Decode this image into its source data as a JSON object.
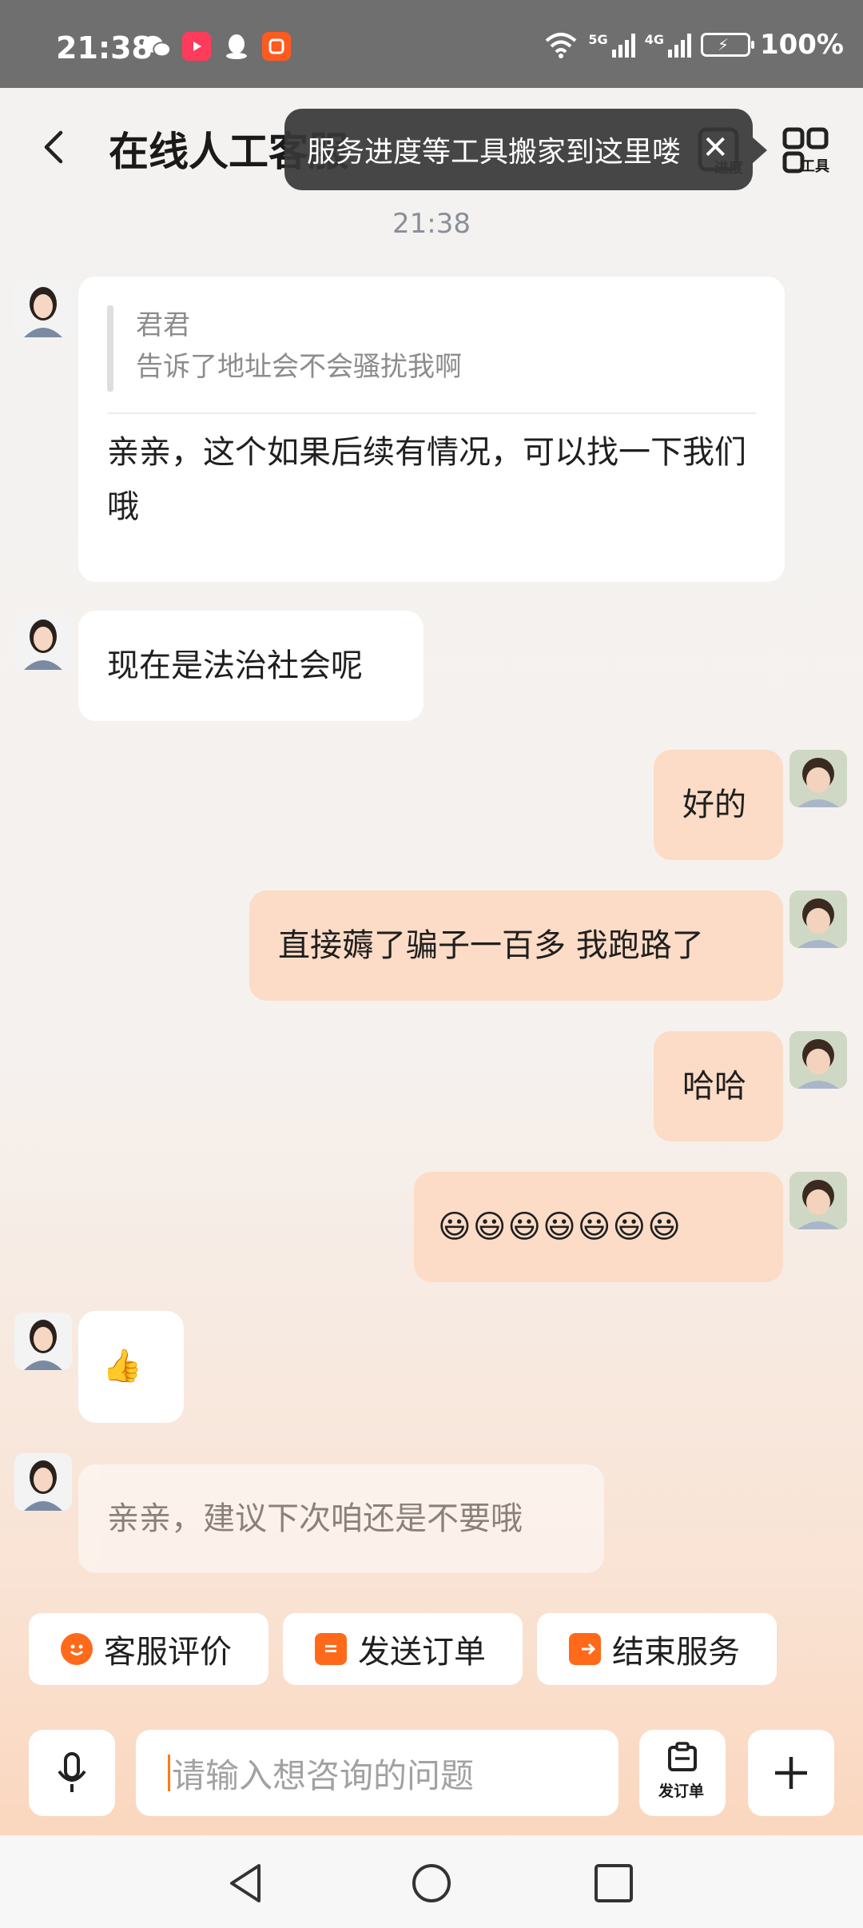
{
  "status_bar": {
    "time": "21:38",
    "network_1": "5G",
    "network_2": "4G",
    "battery": "100%",
    "icons": [
      "wechat-icon",
      "video-app-icon",
      "qq-icon",
      "shopping-app-icon",
      "wifi-icon",
      "signal-icon",
      "battery-icon"
    ]
  },
  "header": {
    "title": "在线人工客服",
    "progress_label": "进度",
    "tools_label": "工具",
    "tooltip_text": "服务进度等工具搬家到这里喽",
    "tooltip_close": "✕"
  },
  "chat": {
    "timestamp": "21:38",
    "messages": [
      {
        "from": "agent",
        "quote_name": "君君",
        "quote_text": "告诉了地址会不会骚扰我啊",
        "text": "亲亲，这个如果后续有情况，可以找一下我们哦"
      },
      {
        "from": "agent",
        "text": "现在是法治社会呢"
      },
      {
        "from": "user",
        "text": "好的"
      },
      {
        "from": "user",
        "text": "直接薅了骗子一百多 我跑路了"
      },
      {
        "from": "user",
        "text": "哈哈"
      },
      {
        "from": "user",
        "text": "😃😃😃😃😃😃😃"
      },
      {
        "from": "agent",
        "text": "👍"
      },
      {
        "from": "agent",
        "text": "亲亲，建议下次咱还是不要哦",
        "pending": true
      }
    ]
  },
  "quick_actions": [
    {
      "label": "客服评价",
      "icon": "smile-icon"
    },
    {
      "label": "发送订单",
      "icon": "clipboard-icon"
    },
    {
      "label": "结束服务",
      "icon": "exit-icon"
    }
  ],
  "input_bar": {
    "placeholder": "请输入想咨询的问题",
    "order_label": "发订单"
  },
  "colors": {
    "accent": "#ff6a1a",
    "user_bubble": "#fcdcc6",
    "agent_bubble": "#ffffff",
    "status_bar": "#6f6f6f"
  }
}
